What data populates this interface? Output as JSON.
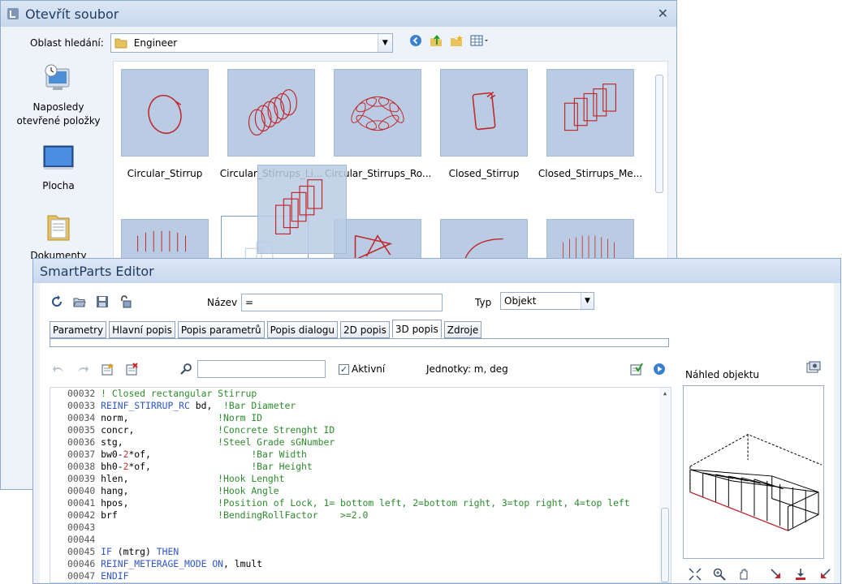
{
  "open_dialog": {
    "title": "Otevřít soubor",
    "close_label": "✕",
    "lookin_label": "Oblast hledání:",
    "lookin_value": "Engineer",
    "places": [
      {
        "label": "Naposledy otevřené položky",
        "icon": "recent-items-icon"
      },
      {
        "label": "Plocha",
        "icon": "desktop-icon"
      },
      {
        "label": "Dokumenty",
        "icon": "documents-icon"
      }
    ],
    "files_row1": [
      "Circular_Stirrup",
      "Circular_Stirrups_Li...",
      "Circular_Stirrups_Ro...",
      "Closed_Stirrup",
      "Closed_Stirrups_Me..."
    ],
    "nav_icons": [
      "back-icon",
      "up-folder-icon",
      "new-folder-icon",
      "view-menu-icon"
    ]
  },
  "editor": {
    "title": "SmartParts Editor",
    "name_label": "Název",
    "name_value": "=",
    "type_label": "Typ",
    "type_value": "Objekt",
    "tabs": [
      "Parametry",
      "Hlavní popis",
      "Popis parametrů",
      "Popis dialogu",
      "2D popis",
      "3D popis",
      "Zdroje"
    ],
    "active_tab": "3D popis",
    "active_label": "Aktivní",
    "units_label": "Jednotky: m, deg",
    "preview_title": "Náhled objektu",
    "code_lines": [
      {
        "n": "00032",
        "parts": [
          [
            "cm",
            "! Closed rectangular Stirrup"
          ]
        ]
      },
      {
        "n": "00033",
        "parts": [
          [
            "kw",
            "REINF_STIRRUP_RC"
          ],
          [
            "",
            " bd,  "
          ],
          [
            "cm",
            "!Bar Diameter"
          ]
        ]
      },
      {
        "n": "00034",
        "parts": [
          [
            "",
            "norm,                "
          ],
          [
            "cm",
            "!Norm ID"
          ]
        ]
      },
      {
        "n": "00035",
        "parts": [
          [
            "",
            "concr,               "
          ],
          [
            "cm",
            "!Concrete Strenght ID"
          ]
        ]
      },
      {
        "n": "00036",
        "parts": [
          [
            "",
            "stg,                 "
          ],
          [
            "cm",
            "!Steel Grade sGNumber"
          ]
        ]
      },
      {
        "n": "00037",
        "parts": [
          [
            "",
            "bw0-"
          ],
          [
            "op",
            "2"
          ],
          [
            "",
            "*of,                  "
          ],
          [
            "cm",
            "!Bar Width"
          ]
        ]
      },
      {
        "n": "00038",
        "parts": [
          [
            "",
            "bh0-"
          ],
          [
            "op",
            "2"
          ],
          [
            "",
            "*of,                  "
          ],
          [
            "cm",
            "!Bar Height"
          ]
        ]
      },
      {
        "n": "00039",
        "parts": [
          [
            "",
            "hlen,                "
          ],
          [
            "cm",
            "!Hook Lenght"
          ]
        ]
      },
      {
        "n": "00040",
        "parts": [
          [
            "",
            "hang,                "
          ],
          [
            "cm",
            "!Hook Angle"
          ]
        ]
      },
      {
        "n": "00041",
        "parts": [
          [
            "",
            "hpos,                "
          ],
          [
            "cm",
            "!Position of Lock, 1= bottom left, 2=bottom right, 3=top right, 4=top left"
          ]
        ]
      },
      {
        "n": "00042",
        "parts": [
          [
            "",
            "brf                  "
          ],
          [
            "cm",
            "!BendingRollFactor    >=2.0"
          ]
        ]
      },
      {
        "n": "00043",
        "parts": []
      },
      {
        "n": "00044",
        "parts": []
      },
      {
        "n": "00045",
        "parts": [
          [
            "kw",
            "IF"
          ],
          [
            "",
            " (mtrg) "
          ],
          [
            "kw",
            "THEN"
          ]
        ]
      },
      {
        "n": "00046",
        "parts": [
          [
            "kw",
            "REINF_METERAGE_MODE"
          ],
          [
            "",
            " "
          ],
          [
            "kw",
            "ON"
          ],
          [
            "",
            ", lmult"
          ]
        ]
      },
      {
        "n": "00047",
        "parts": [
          [
            "kw",
            "ENDIF"
          ]
        ]
      }
    ]
  },
  "colors": {
    "accent": "#1e3a5f",
    "thumb": "#b9cce4",
    "stirrup": "#c0282d",
    "keyword": "#2f55c8",
    "comment": "#2d8a2d"
  }
}
